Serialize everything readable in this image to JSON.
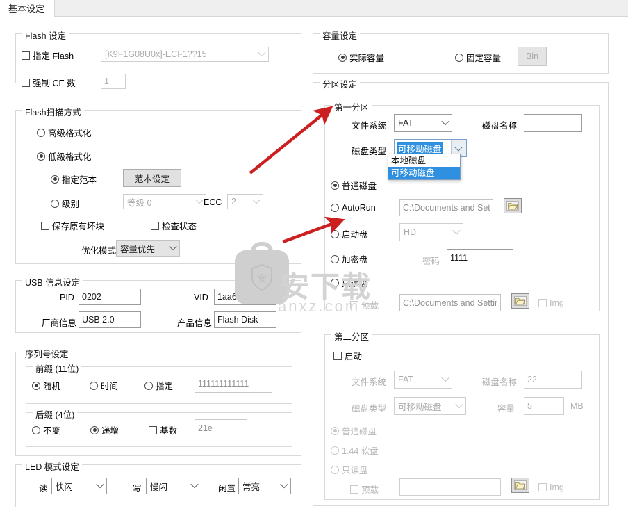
{
  "window": {
    "tab_label": "基本设定"
  },
  "flash_settings": {
    "title": "Flash 设定",
    "specify_flash_label": "指定 Flash",
    "specify_flash_checked": false,
    "flash_model": "[K9F1G08U0x]-ECF1??15",
    "force_ce_label": "强制 CE 数",
    "force_ce_checked": false,
    "force_ce_value": "1"
  },
  "flash_scan": {
    "title": "Flash扫描方式",
    "high_format_label": "高级格式化",
    "low_format_label": "低级格式化",
    "selected_format": "低级格式化",
    "specify_template_label": "指定范本",
    "template_button_label": "范本设定",
    "level_label": "级别",
    "level_value": "等级 0",
    "ecc_label": "ECC",
    "ecc_value": "2",
    "keep_bad_blocks_label": "保存原有坏块",
    "keep_bad_blocks_checked": false,
    "check_status_label": "检查状态",
    "check_status_checked": false,
    "optimize_label": "优化模式",
    "optimize_value": "容量优先"
  },
  "usb_info": {
    "title": "USB 信息设定",
    "pid_label": "PID",
    "pid_value": "0202",
    "vid_label": "VID",
    "vid_value": "1aa6",
    "vendor_label": "厂商信息",
    "vendor_value": "USB 2.0",
    "product_label": "产品信息",
    "product_value": "Flash Disk"
  },
  "serial": {
    "title": "序列号设定",
    "prefix": {
      "title": "前缀 (11位)",
      "random_label": "随机",
      "time_label": "时间",
      "specify_label": "指定",
      "selected": "随机",
      "specify_value": "111111111111"
    },
    "suffix": {
      "title": "后缀 (4位)",
      "fixed_label": "不变",
      "increment_label": "递增",
      "selected": "递增",
      "radix_label": "基数",
      "radix_checked": false,
      "radix_value": "21e"
    }
  },
  "led": {
    "title": "LED 模式设定",
    "read_label": "读",
    "read_value": "快闪",
    "write_label": "写",
    "write_value": "慢闪",
    "idle_label": "闲置",
    "idle_value": "常亮"
  },
  "capacity": {
    "title": "容量设定",
    "actual_label": "实际容量",
    "fixed_label": "固定容量",
    "selected": "实际容量",
    "bin_button_label": "Bin"
  },
  "partition": {
    "title": "分区设定",
    "first": {
      "title": "第一分区",
      "fs_label": "文件系统",
      "fs_value": "FAT",
      "disk_name_label": "磁盘名称",
      "disk_name_value": "",
      "disk_type_label": "磁盘类型",
      "disk_type_value": "可移动磁盘",
      "disk_type_options": [
        "本地磁盘",
        "可移动磁盘"
      ],
      "disk_type_selected": "可移动磁盘",
      "normal_disk_label": "普通磁盘",
      "autorun_label": "AutoRun",
      "autorun_path": "C:\\Documents and Set",
      "boot_label": "启动盘",
      "boot_value": "HD",
      "encrypt_label": "加密盘",
      "password_label": "密码",
      "password_value": "1111",
      "readonly_label": "只读盘",
      "selected_mode": "普通磁盘",
      "preload_label": "预载",
      "preload_checked": false,
      "preload_path": "C:\\Documents and Settir",
      "img_label": "Img",
      "img_checked": false,
      "folder_icon": "folder-icon"
    },
    "second": {
      "title": "第二分区",
      "enable_label": "启动",
      "enable_checked": false,
      "fs_label": "文件系统",
      "fs_value": "FAT",
      "disk_name_label": "磁盘名称",
      "disk_name_value": "22",
      "disk_type_label": "磁盘类型",
      "disk_type_value": "可移动磁盘",
      "capacity_label": "容量",
      "capacity_value": "5",
      "capacity_unit": "MB",
      "normal_disk_label": "普通磁盘",
      "floppy_label": "1.44 软盘",
      "readonly_label": "只读盘",
      "selected_mode": "普通磁盘",
      "preload_label": "预载",
      "preload_checked": false,
      "preload_path": "",
      "img_label": "Img",
      "img_checked": false,
      "folder_icon": "folder-icon"
    }
  },
  "watermark": {
    "text": "安下载",
    "url": "anxz.com",
    "shield_char": "安"
  },
  "colors": {
    "accent": "#2f8fe0",
    "arrow": "#cc1f1f",
    "border": "#d9d9d9"
  }
}
